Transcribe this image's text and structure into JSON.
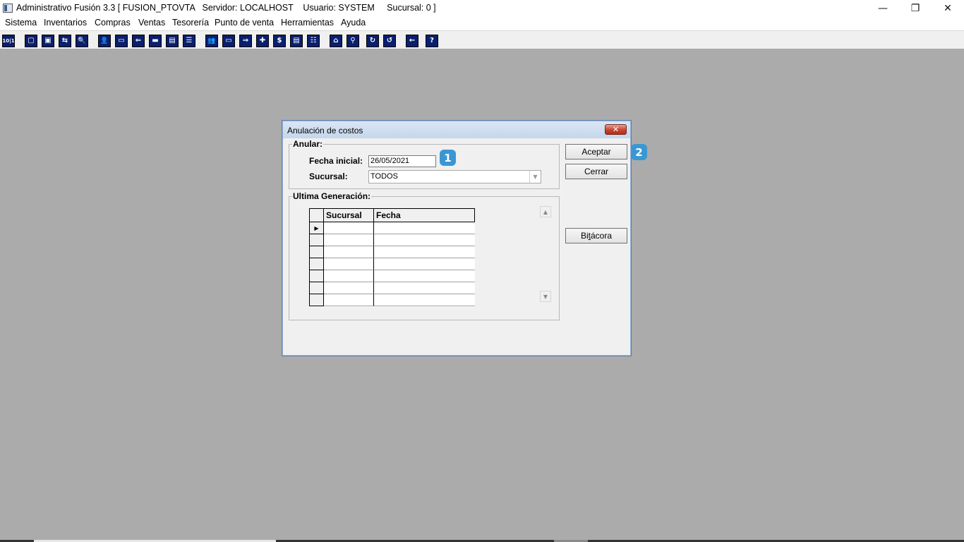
{
  "window": {
    "title": "Administrativo Fusión 3.3 [ FUSION_PTOVTA   Servidor: LOCALHOST    Usuario: SYSTEM     Sucursal: 0 ]",
    "minimize_glyph": "—",
    "restore_glyph": "❐",
    "close_glyph": "✕"
  },
  "menu": [
    "Sistema",
    "Inventarios",
    "Compras",
    "Ventas",
    "Tesorería",
    "Punto de venta",
    "Herramientas",
    "Ayuda"
  ],
  "toolbar": {
    "icons": [
      "calculator-icon",
      "copy-icon",
      "paste-icon",
      "transfer-icon",
      "search-doc-icon",
      "user-icon",
      "folder-icon",
      "import-icon",
      "print-icon",
      "document-icon",
      "list-icon",
      "people-icon",
      "open-folder-icon",
      "export-icon",
      "add-icon",
      "money-icon",
      "report-icon",
      "tree-list-icon",
      "home-icon",
      "zoom-icon",
      "refresh-icon",
      "undo-icon",
      "back-icon",
      "help-icon"
    ],
    "icon_glyphs": [
      "10|1",
      "▢",
      "▣",
      "⇆",
      "🔍",
      "👤",
      "▭",
      "⇐",
      "▬",
      "▤",
      "☰",
      "👥",
      "▭",
      "⇒",
      "✚",
      "$",
      "▤",
      "☷",
      "⌂",
      "⚲",
      "↻",
      "↺",
      "←",
      "?"
    ]
  },
  "dialog": {
    "title": "Anulación de costos",
    "close_glyph": "✕",
    "anular_group": {
      "label": "Anular:",
      "fecha_label": "Fecha inicial:",
      "fecha_value": "26/05/2021",
      "sucursal_label": "Sucursal:",
      "sucursal_value": "TODOS"
    },
    "ultima_group": {
      "label": "Ultima Generación:",
      "columns": [
        "Sucursal",
        "Fecha"
      ],
      "row_count": 7,
      "current_row_marker": "▶"
    },
    "buttons": {
      "aceptar": "Aceptar",
      "cerrar": "Cerrar",
      "bitacora_prefix": "Bi",
      "bitacora_underlined": "t",
      "bitacora_suffix": "ácora"
    }
  },
  "callouts": {
    "badge1": "1",
    "badge2": "2"
  },
  "colors": {
    "desktop": "#ababab",
    "toolbar_icon": "#0a1f6e",
    "badge": "#3a97d4",
    "dialog_border": "#5e7fae"
  }
}
